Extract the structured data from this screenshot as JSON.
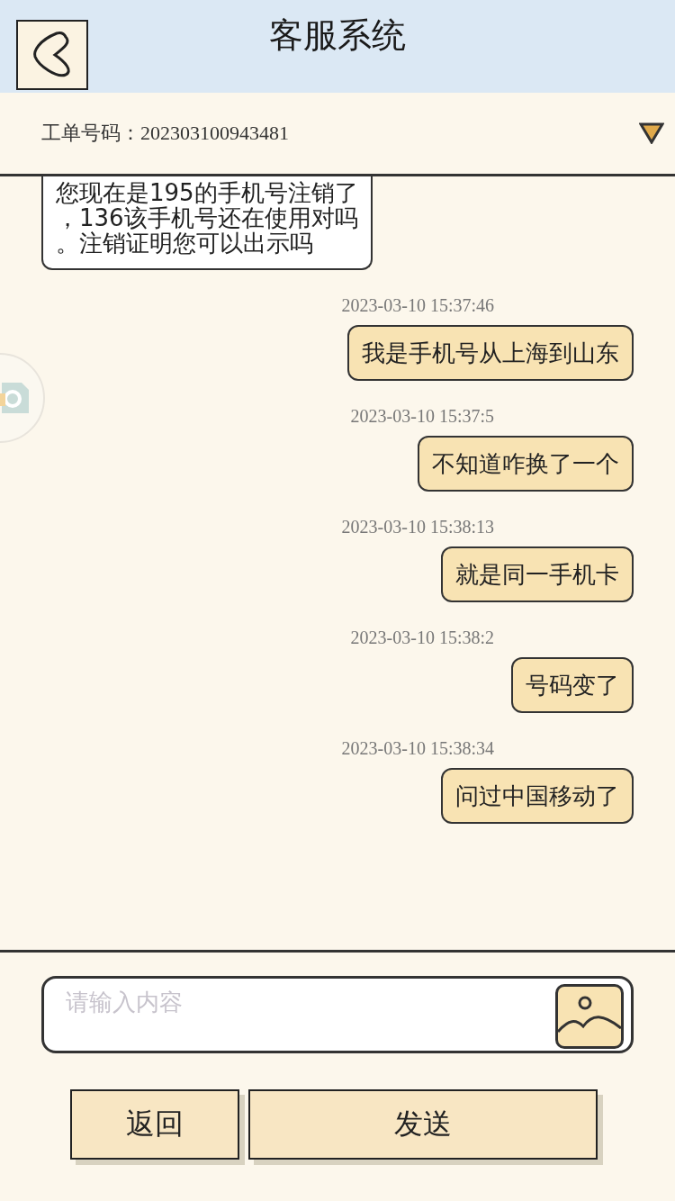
{
  "header": {
    "title": "客服系统"
  },
  "ticket": {
    "label": "工单号码：",
    "number": "202303100943481",
    "expanded": false
  },
  "messages": [
    {
      "kind": "received",
      "lines": [
        "您现在是195的手机号注销了",
        "，136该手机号还在使用对吗",
        "。注销证明您可以出示吗"
      ]
    },
    {
      "kind": "sent",
      "time": "2023-03-10 15:37:46",
      "lines": [
        "我是手机号从上海到山东"
      ]
    },
    {
      "kind": "sent",
      "time": "2023-03-10 15:37:5",
      "lines": [
        "不知道咋换了一个"
      ]
    },
    {
      "kind": "sent",
      "time": "2023-03-10 15:38:13",
      "lines": [
        "就是同一手机卡"
      ]
    },
    {
      "kind": "sent",
      "time": "2023-03-10 15:38:2",
      "lines": [
        "号码变了"
      ]
    },
    {
      "kind": "sent",
      "time": "2023-03-10 15:38:34",
      "lines": [
        "问过中国移动了"
      ]
    }
  ],
  "input": {
    "placeholder": "请输入内容"
  },
  "buttons": [
    {
      "label": "返回",
      "kind": "back"
    },
    {
      "label": "发送",
      "kind": "send"
    }
  ]
}
